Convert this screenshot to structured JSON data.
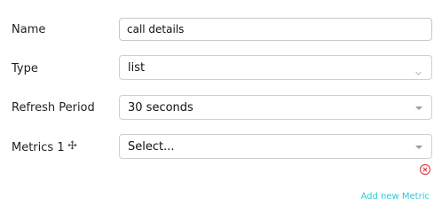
{
  "form": {
    "name": {
      "label": "Name",
      "value": "call details"
    },
    "type": {
      "label": "Type",
      "value": "list"
    },
    "refresh_period": {
      "label": "Refresh Period",
      "value": "30 seconds"
    },
    "metrics": {
      "label": "Metrics 1",
      "placeholder": "Select..."
    },
    "add_metric_label": "Add new Metric"
  },
  "icons": {
    "drag_handle": "move-icon",
    "remove_metric": "remove-circle-icon",
    "type_dropdown": "chevron-down-icon",
    "select_dropdown": "caret-down-icon"
  },
  "colors": {
    "accent": "#30c6d5",
    "danger": "#e24b4b",
    "border": "#cfcfcf"
  }
}
